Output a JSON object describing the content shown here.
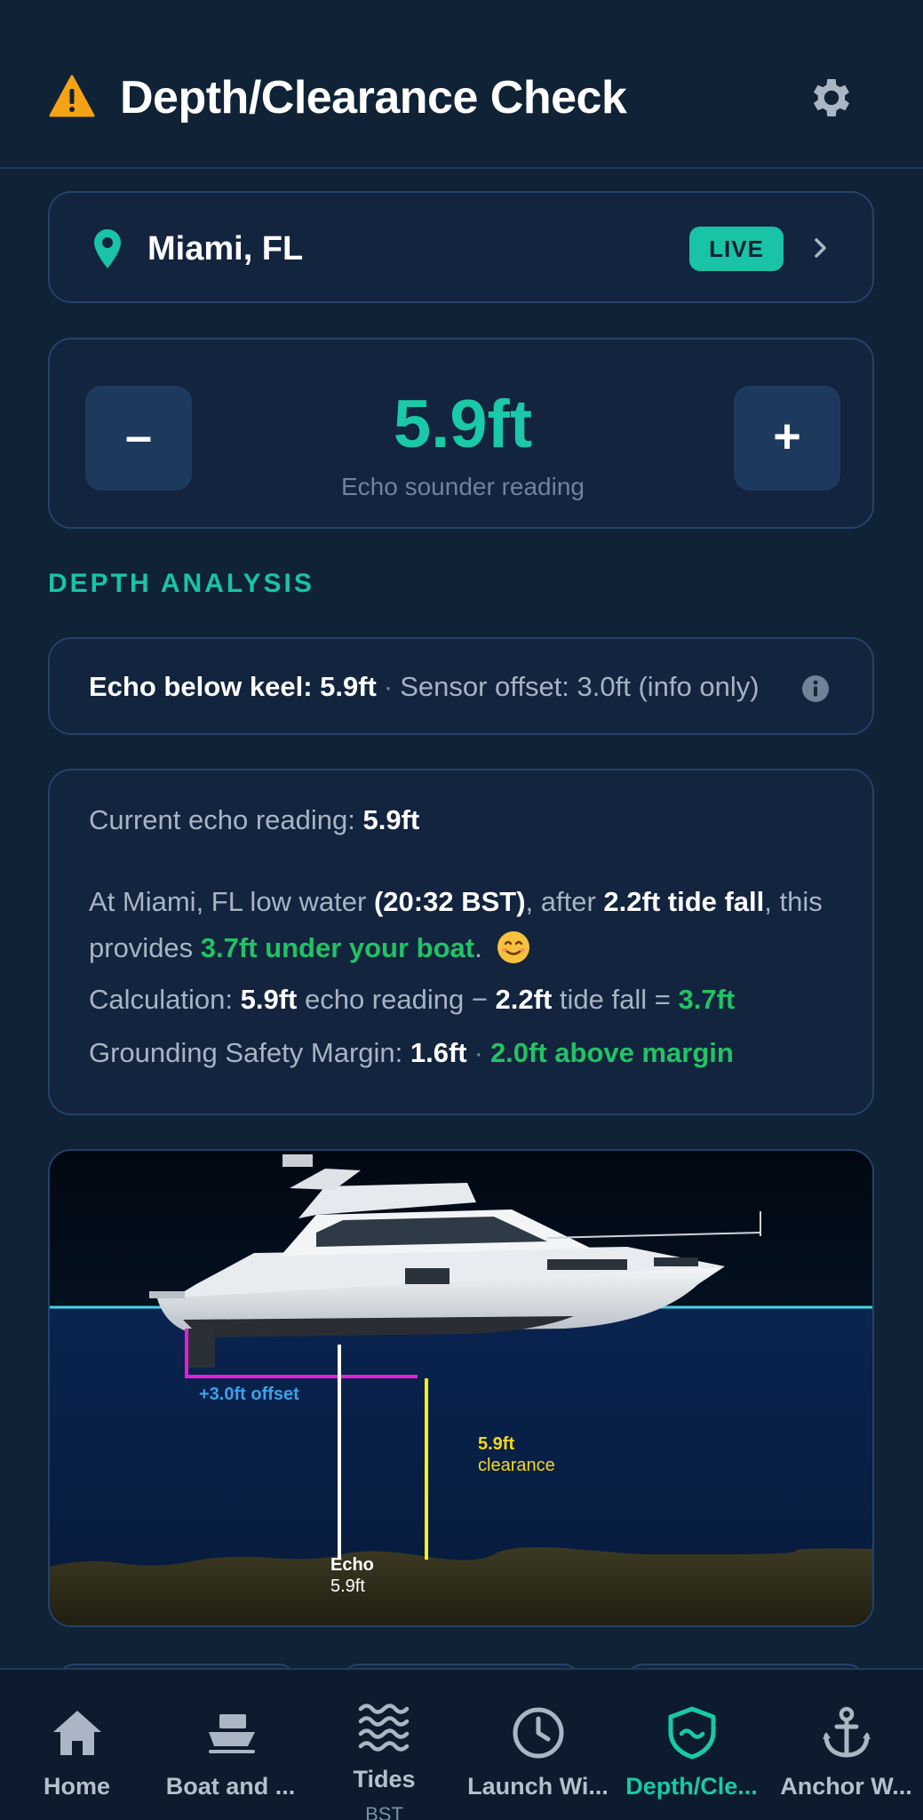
{
  "header": {
    "title": "Depth/Clearance Check",
    "warning_icon": "warning-triangle-icon",
    "settings_icon": "gear-icon"
  },
  "location": {
    "name": "Miami, FL",
    "badge": "LIVE"
  },
  "echo": {
    "value": "5.9ft",
    "label": "Echo sounder reading",
    "minus_label": "–",
    "plus_label": "+"
  },
  "section_title": "DEPTH ANALYSIS",
  "offset_info": {
    "echo_label": "Echo below keel: 5.9ft",
    "sensor_text": "Sensor offset: 3.0ft (info only)"
  },
  "analysis": {
    "current_prefix": "Current echo reading: ",
    "current_value": "5.9ft",
    "p2_a": "At Miami, FL low water ",
    "p2_time": "(20:32 BST)",
    "p2_b": ", after ",
    "p2_fall": "2.2ft tide fall",
    "p2_c": ", this provides ",
    "p2_result": "3.7ft under your boat",
    "p2_d": ".",
    "calc_prefix": "Calculation: ",
    "calc_echo": "5.9ft",
    "calc_mid1": " echo reading − ",
    "calc_fall": "2.2ft",
    "calc_mid2": " tide fall = ",
    "calc_result": "3.7ft",
    "margin_prefix": "Grounding Safety Margin: ",
    "margin_value": "1.6ft",
    "margin_result": "2.0ft above margin"
  },
  "diagram": {
    "offset_label": "+3.0ft offset",
    "clearance_value": "5.9ft",
    "clearance_label": "clearance",
    "echo_label": "Echo",
    "echo_value": "5.9ft"
  },
  "colors": {
    "accent": "#19c9a8",
    "good": "#22c363",
    "offset_magenta": "#e81ed8",
    "clearance_yellow": "#f4f01c"
  },
  "nav": [
    {
      "label": "Home",
      "icon": "home-icon"
    },
    {
      "label": "Boat and ...",
      "icon": "boat-icon"
    },
    {
      "label": "Tides",
      "sub": "BST",
      "icon": "waves-icon"
    },
    {
      "label": "Launch Wi...",
      "icon": "clock-icon"
    },
    {
      "label": "Depth/Cle...",
      "icon": "shield-wave-icon",
      "active": true
    },
    {
      "label": "Anchor W...",
      "icon": "anchor-icon"
    }
  ]
}
